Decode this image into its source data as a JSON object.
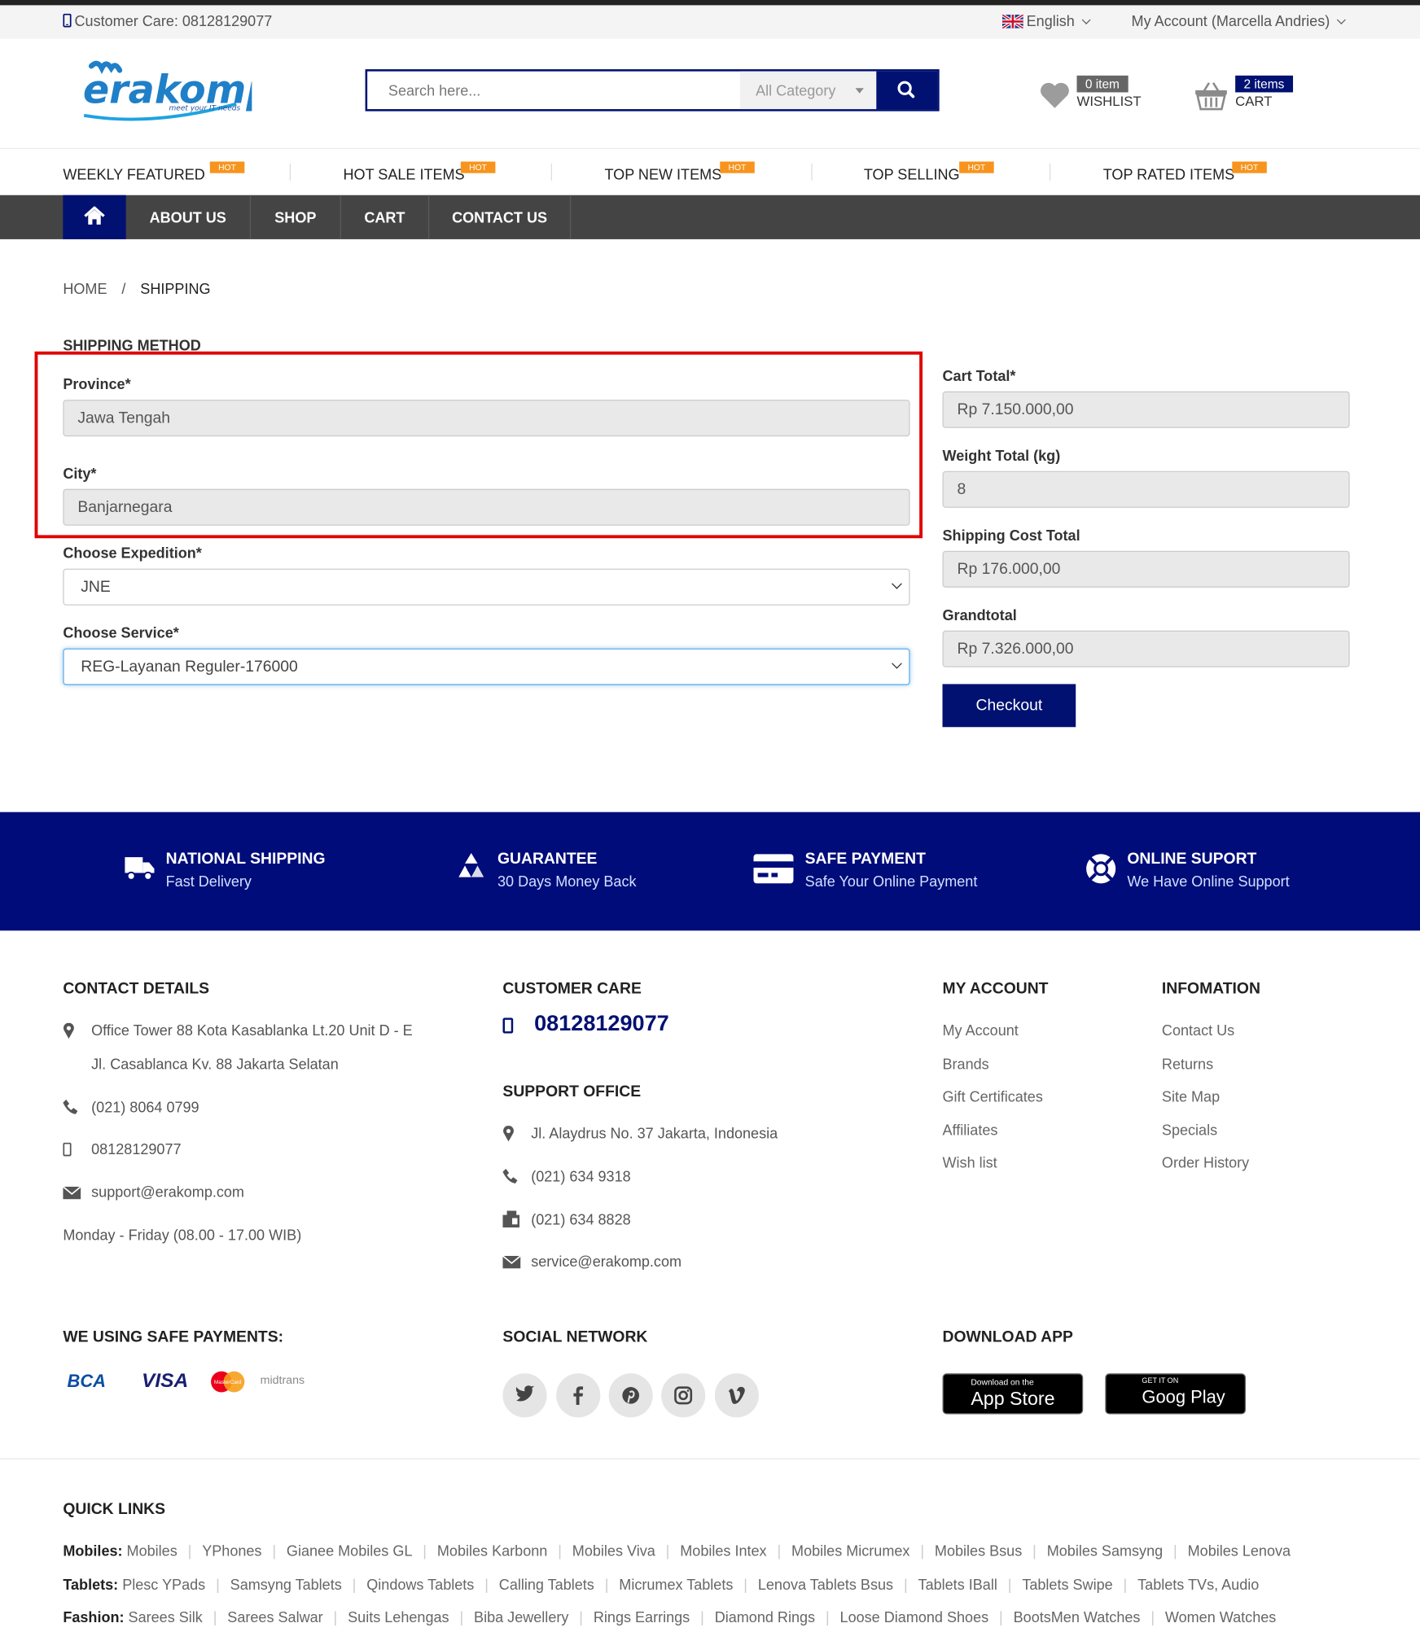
{
  "topbar": {
    "customer_care": "Customer Care: 08128129077",
    "language": "English",
    "account": "My Account (Marcella Andries)"
  },
  "header": {
    "logo_text": "erakomp",
    "logo_tagline": "meet your IT needs",
    "search_placeholder": "Search here...",
    "category": "All Category",
    "wishlist_badge": "0 item",
    "wishlist_label": "WISHLIST",
    "cart_badge": "2 items",
    "cart_label": "CART"
  },
  "featured_nav": [
    {
      "label": "WEEKLY FEATURED",
      "tag": "HOT"
    },
    {
      "label": "HOT SALE ITEMS",
      "tag": "HOT"
    },
    {
      "label": "TOP NEW ITEMS",
      "tag": "HOT"
    },
    {
      "label": "TOP SELLING",
      "tag": "HOT"
    },
    {
      "label": "TOP RATED ITEMS",
      "tag": "HOT"
    }
  ],
  "main_nav": [
    "ABOUT US",
    "SHOP",
    "CART",
    "CONTACT US"
  ],
  "breadcrumb": {
    "home": "HOME",
    "sep": "/",
    "current": "SHIPPING"
  },
  "shipping": {
    "title": "SHIPPING METHOD",
    "province_label": "Province*",
    "province_value": "Jawa Tengah",
    "city_label": "City*",
    "city_value": "Banjarnegara",
    "expedition_label": "Choose Expedition*",
    "expedition_value": "JNE",
    "service_label": "Choose Service*",
    "service_value": "REG-Layanan Reguler-176000"
  },
  "summary": {
    "cart_total_label": "Cart Total*",
    "cart_total_value": "Rp 7.150.000,00",
    "weight_label": "Weight Total (kg)",
    "weight_value": "8",
    "shipping_label": "Shipping Cost Total",
    "shipping_value": "Rp 176.000,00",
    "grand_label": "Grandtotal",
    "grand_value": "Rp 7.326.000,00",
    "checkout": "Checkout"
  },
  "features": [
    {
      "title": "NATIONAL SHIPPING",
      "sub": "Fast Delivery",
      "icon": "truck-icon"
    },
    {
      "title": "GUARANTEE",
      "sub": "30 Days Money Back",
      "icon": "recycle-icon"
    },
    {
      "title": "SAFE PAYMENT",
      "sub": "Safe Your Online Payment",
      "icon": "credit-card-icon"
    },
    {
      "title": "ONLINE SUPORT",
      "sub": "We Have Online Support",
      "icon": "lifebuoy-icon"
    }
  ],
  "footer": {
    "contact_title": "CONTACT DETAILS",
    "address1": "Office Tower 88 Kota Kasablanka Lt.20 Unit D - E",
    "address2": "Jl. Casablanca Kv. 88 Jakarta Selatan",
    "phone": "(021) 8064 0799",
    "mobile": "08128129077",
    "email": "support@erakomp.com",
    "hours": "Monday - Friday (08.00 - 17.00 WIB)",
    "care_title": "CUSTOMER CARE",
    "care_phone": "08128129077",
    "support_title": "SUPPORT OFFICE",
    "support_address": "Jl. Alaydrus No. 37 Jakarta, Indonesia",
    "support_phone": "(021) 634 9318",
    "support_fax": "(021) 634 8828",
    "support_email": "service@erakomp.com",
    "account_title": "MY ACCOUNT",
    "account_links": [
      "My Account",
      "Brands",
      "Gift Certificates",
      "Affiliates",
      "Wish list"
    ],
    "info_title": "INFOMATION",
    "info_links": [
      "Contact Us",
      "Returns",
      "Site Map",
      "Specials",
      "Order History"
    ],
    "payments_title": "WE USING SAFE PAYMENTS:",
    "payments": [
      "BCA",
      "VISA",
      "MasterCard",
      "midtrans"
    ],
    "social_title": "SOCIAL NETWORK",
    "social": [
      "twitter-icon",
      "facebook-icon",
      "pinterest-icon",
      "instagram-icon",
      "vimeo-icon"
    ],
    "app_title": "DOWNLOAD APP",
    "appstore_small": "Download on the",
    "appstore_big": "App Store",
    "gplay_small": "GET IT ON",
    "gplay_big": "Goog Play"
  },
  "quick_links": {
    "title": "QUICK LINKS",
    "rows": [
      {
        "label": "Mobiles:",
        "items": [
          "Mobiles",
          "YPhones",
          "Gianee Mobiles GL",
          "Mobiles Karbonn",
          "Mobiles Viva",
          "Mobiles Intex",
          "Mobiles Micrumex",
          "Mobiles Bsus",
          "Mobiles Samsyng",
          "Mobiles Lenova"
        ]
      },
      {
        "label": "Tablets:",
        "items": [
          "Plesc YPads",
          "Samsyng Tablets",
          "Qindows Tablets",
          "Calling Tablets",
          "Micrumex Tablets",
          "Lenova Tablets Bsus",
          "Tablets IBall",
          "Tablets Swipe",
          "Tablets TVs, Audio"
        ]
      },
      {
        "label": "Fashion:",
        "items": [
          "Sarees Silk",
          "Sarees Salwar",
          "Suits Lehengas",
          "Biba Jewellery",
          "Rings Earrings",
          "Diamond Rings",
          "Loose Diamond Shoes",
          "BootsMen Watches",
          "Women Watches"
        ]
      }
    ]
  },
  "colors": {
    "brand": "#001172",
    "hot": "#f7941d",
    "highlight": "#e00000"
  }
}
